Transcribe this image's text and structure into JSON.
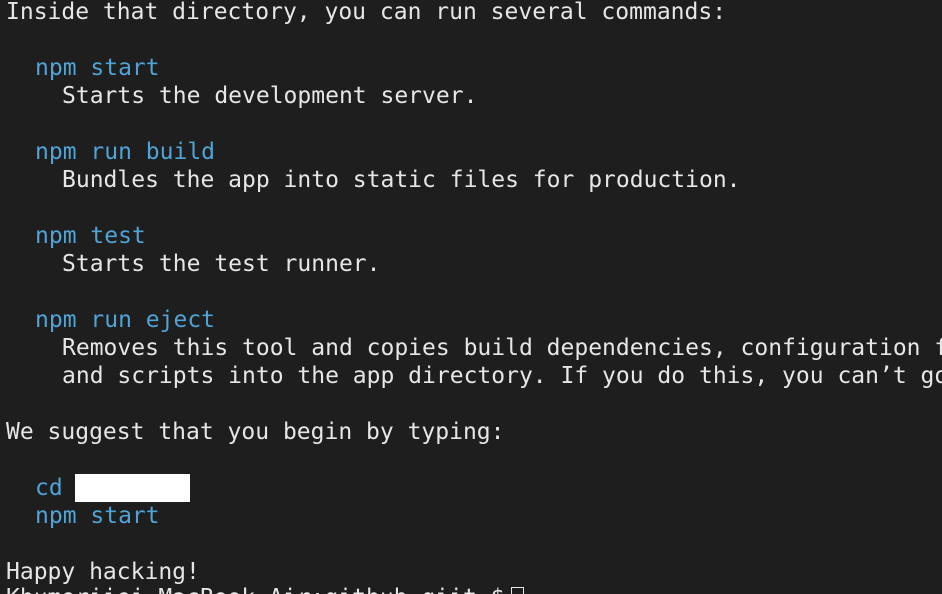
{
  "terminal": {
    "intro": "Inside that directory, you can run several commands:",
    "commands": [
      {
        "cmd": "npm start",
        "desc": [
          "Starts the development server."
        ]
      },
      {
        "cmd": "npm run build",
        "desc": [
          "Bundles the app into static files for production."
        ]
      },
      {
        "cmd": "npm test",
        "desc": [
          "Starts the test runner."
        ]
      },
      {
        "cmd": "npm run eject",
        "desc": [
          "Removes this tool and copies build dependencies, configuration files",
          "and scripts into the app directory. If you do this, you can’t go back!"
        ]
      }
    ],
    "suggest": "We suggest that you begin by typing:",
    "cd_cmd": "cd",
    "start_cmd": "npm start",
    "outro": "Happy hacking!",
    "prompt": "Khumoriiei-MacBook-Air:github-qiit $"
  },
  "colors": {
    "background": "#1e1e1e",
    "text": "#e6e6e6",
    "command": "#4fa3d6"
  }
}
